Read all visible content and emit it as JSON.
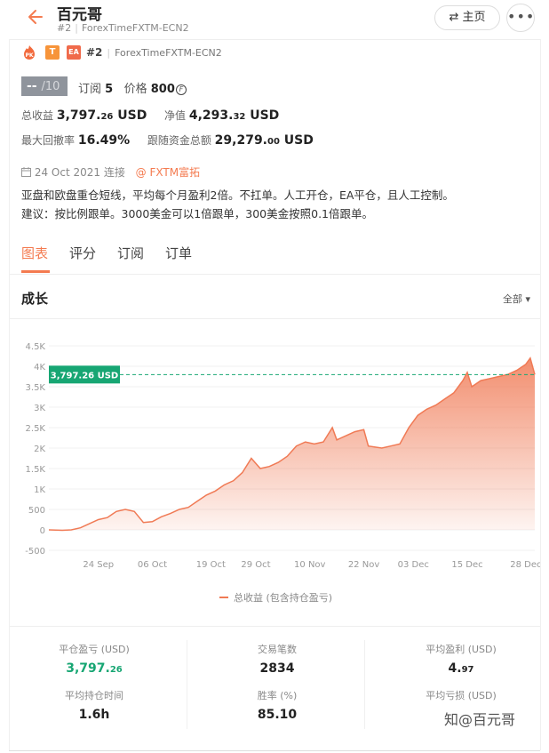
{
  "header": {
    "title": "百元哥",
    "rank": "#2",
    "server": "ForexTimeFXTM-ECN2",
    "home_label": "⇄ 主页",
    "more_label": "•••"
  },
  "badges": {
    "pk_label": "PK",
    "t_label": "T",
    "ea_label": "EA",
    "rank": "#2",
    "server": "ForexTimeFXTM-ECN2"
  },
  "score": {
    "value": "--",
    "denominator": "/10"
  },
  "subscriptions": {
    "label": "订阅",
    "value": "5"
  },
  "price": {
    "label": "价格",
    "value": "800",
    "icon_label": "F"
  },
  "stats": {
    "total_profit_label": "总收益",
    "total_profit_main": "3,797.",
    "total_profit_dec": "26",
    "total_profit_unit": " USD",
    "equity_label": "净值",
    "equity_main": "4,293.",
    "equity_dec": "32",
    "equity_unit": " USD",
    "drawdown_label": "最大回撤率",
    "drawdown_value": "16.49%",
    "follow_funds_label": "跟随资金总额",
    "follow_funds_main": "29,279.",
    "follow_funds_dec": "00",
    "follow_funds_unit": " USD"
  },
  "connection": {
    "date": "24 Oct 2021 连接",
    "broker": "@ FXTM富拓"
  },
  "description": {
    "line1": "亚盘和欧盘重仓短线，平均每个月盈利2倍。不扛单。人工开仓，EA平仓，且人工控制。",
    "line2": "建议：按比例跟单。3000美金可以1倍跟单，300美金按照0.1倍跟单。"
  },
  "tabs": [
    "图表",
    "评分",
    "订阅",
    "订单"
  ],
  "growth": {
    "title": "成长",
    "range_label": "全部 ▾"
  },
  "chart_data": {
    "type": "area",
    "title": "",
    "xlabel": "",
    "ylabel": "",
    "series": [
      {
        "name": "总收益 (包含持仓盈亏)",
        "color": "#f07a55"
      }
    ],
    "x_ticks": [
      "24 Sep",
      "06 Oct",
      "19 Oct",
      "29 Oct",
      "10 Nov",
      "22 Nov",
      "03 Dec",
      "15 Dec",
      "28 Dec"
    ],
    "y_ticks": [
      "4.5K",
      "4K",
      "3.5K",
      "3K",
      "2.5K",
      "2K",
      "1.5K",
      "1K",
      "500",
      "0",
      "-500"
    ],
    "ylim": [
      -500,
      4500
    ],
    "grid": true,
    "current_value": 3797.26,
    "current_label": "3,797.26 USD",
    "label_color": "#17a673",
    "points": [
      [
        "2021-09-13",
        0
      ],
      [
        "2021-09-16",
        -10
      ],
      [
        "2021-09-18",
        0
      ],
      [
        "2021-09-20",
        50
      ],
      [
        "2021-09-22",
        150
      ],
      [
        "2021-09-24",
        250
      ],
      [
        "2021-09-26",
        300
      ],
      [
        "2021-09-28",
        450
      ],
      [
        "2021-09-30",
        500
      ],
      [
        "2021-10-02",
        450
      ],
      [
        "2021-10-04",
        180
      ],
      [
        "2021-10-06",
        200
      ],
      [
        "2021-10-08",
        320
      ],
      [
        "2021-10-10",
        400
      ],
      [
        "2021-10-12",
        500
      ],
      [
        "2021-10-14",
        550
      ],
      [
        "2021-10-16",
        700
      ],
      [
        "2021-10-18",
        850
      ],
      [
        "2021-10-20",
        950
      ],
      [
        "2021-10-22",
        1100
      ],
      [
        "2021-10-24",
        1200
      ],
      [
        "2021-10-26",
        1400
      ],
      [
        "2021-10-28",
        1750
      ],
      [
        "2021-10-30",
        1500
      ],
      [
        "2021-11-01",
        1550
      ],
      [
        "2021-11-03",
        1650
      ],
      [
        "2021-11-05",
        1800
      ],
      [
        "2021-11-07",
        2050
      ],
      [
        "2021-11-09",
        2150
      ],
      [
        "2021-11-11",
        2100
      ],
      [
        "2021-11-13",
        2150
      ],
      [
        "2021-11-15",
        2500
      ],
      [
        "2021-11-16",
        2200
      ],
      [
        "2021-11-18",
        2300
      ],
      [
        "2021-11-20",
        2400
      ],
      [
        "2021-11-22",
        2450
      ],
      [
        "2021-11-23",
        2050
      ],
      [
        "2021-11-26",
        2000
      ],
      [
        "2021-11-28",
        2050
      ],
      [
        "2021-11-30",
        2100
      ],
      [
        "2021-12-02",
        2500
      ],
      [
        "2021-12-04",
        2800
      ],
      [
        "2021-12-06",
        2950
      ],
      [
        "2021-12-08",
        3050
      ],
      [
        "2021-12-10",
        3200
      ],
      [
        "2021-12-12",
        3350
      ],
      [
        "2021-12-14",
        3650
      ],
      [
        "2021-12-15",
        3850
      ],
      [
        "2021-12-16",
        3500
      ],
      [
        "2021-12-18",
        3650
      ],
      [
        "2021-12-20",
        3700
      ],
      [
        "2021-12-22",
        3750
      ],
      [
        "2021-12-24",
        3800
      ],
      [
        "2021-12-26",
        3900
      ],
      [
        "2021-12-28",
        4050
      ],
      [
        "2021-12-29",
        4200
      ],
      [
        "2021-12-30",
        3797.26
      ]
    ]
  },
  "stats_grid": [
    {
      "label": "平仓盈亏 (USD)",
      "main": "3,797.",
      "dec": "26",
      "highlight": true
    },
    {
      "label": "交易笔数",
      "main": "2834",
      "dec": ""
    },
    {
      "label": "平均盈利 (USD)",
      "main": "4.",
      "dec": "97"
    },
    {
      "label": "平均持仓时间",
      "main": "1.6h",
      "dec": ""
    },
    {
      "label": "胜率 (%)",
      "main": "85.10",
      "dec": ""
    },
    {
      "label": "平均亏损 (USD)",
      "main": "",
      "dec": ""
    }
  ],
  "watermark": "知@百元哥"
}
